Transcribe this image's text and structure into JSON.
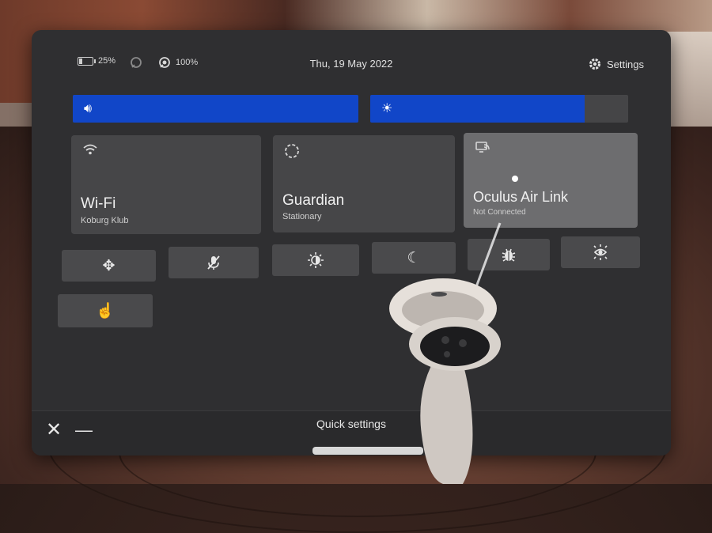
{
  "status": {
    "headset_battery": "25%",
    "controller_battery": "100%",
    "date": "Thu, 19 May 2022",
    "settings_label": "Settings"
  },
  "sliders": {
    "volume_level": 1.0,
    "brightness_level": 0.83
  },
  "tiles": {
    "wifi": {
      "title": "Wi-Fi",
      "subtitle": "Koburg Klub"
    },
    "guardian": {
      "title": "Guardian",
      "subtitle": "Stationary"
    },
    "airlink": {
      "title": "Oculus Air Link",
      "subtitle": "Not Connected"
    }
  },
  "footer": {
    "title": "Quick settings"
  },
  "icons": [
    "battery-icon",
    "controller-icon",
    "controller-battery-icon",
    "gear-icon",
    "volume-icon",
    "brightness-icon",
    "wifi-icon",
    "guardian-icon",
    "airlink-icon",
    "move-icon",
    "mic-muted-icon",
    "display-icon",
    "night-mode-icon",
    "bug-icon",
    "passthrough-icon",
    "hand-tracking-icon",
    "close-icon",
    "minimize-icon"
  ]
}
